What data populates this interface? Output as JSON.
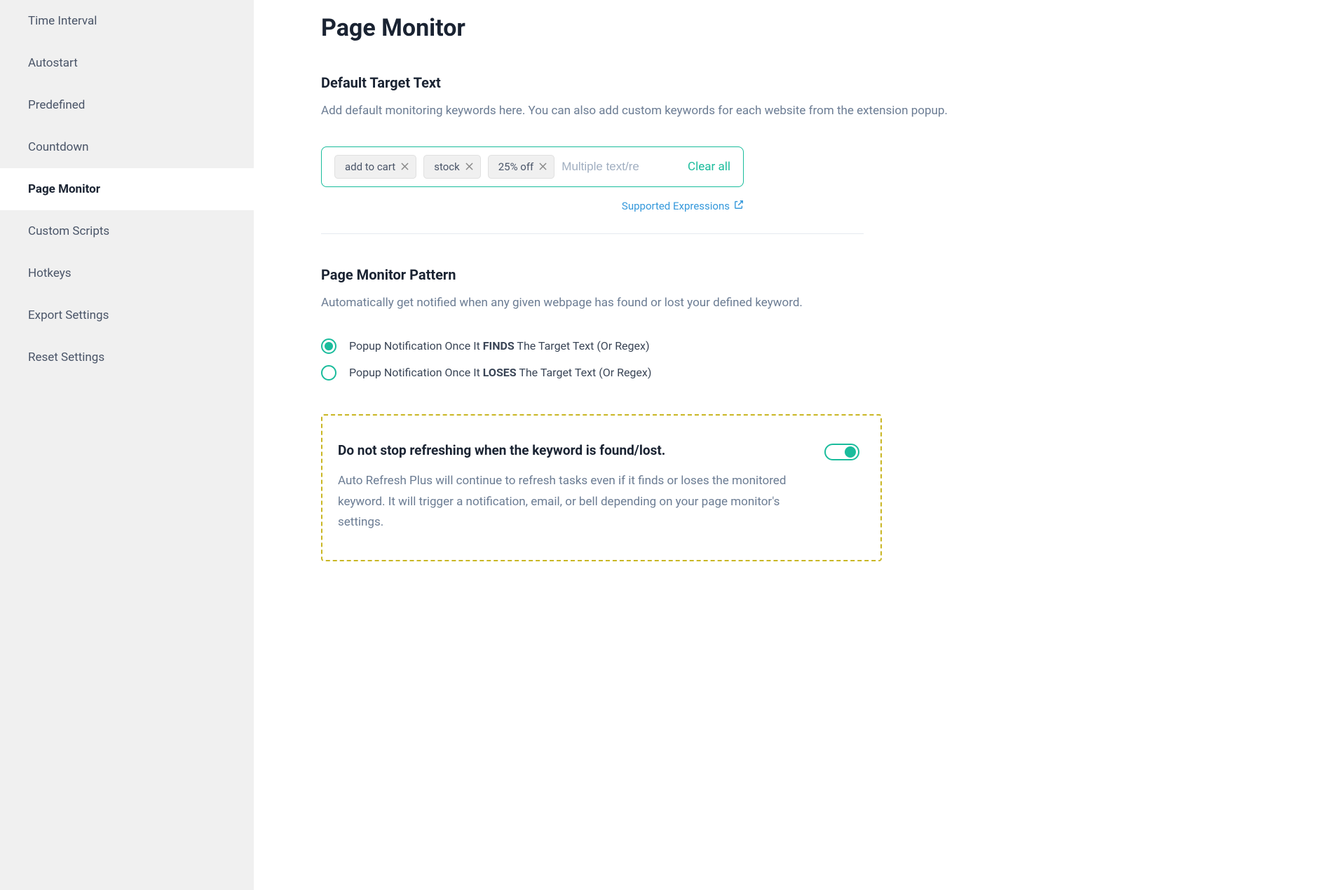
{
  "sidebar": {
    "items": [
      {
        "label": "Time Interval",
        "active": false
      },
      {
        "label": "Autostart",
        "active": false
      },
      {
        "label": "Predefined",
        "active": false
      },
      {
        "label": "Countdown",
        "active": false
      },
      {
        "label": "Page Monitor",
        "active": true
      },
      {
        "label": "Custom Scripts",
        "active": false
      },
      {
        "label": "Hotkeys",
        "active": false
      },
      {
        "label": "Export Settings",
        "active": false
      },
      {
        "label": "Reset Settings",
        "active": false
      }
    ]
  },
  "page": {
    "title": "Page Monitor"
  },
  "default_target": {
    "title": "Default Target Text",
    "description": "Add default monitoring keywords here. You can also add custom keywords for each website from the extension popup.",
    "tags": [
      "add to cart",
      "stock",
      "25% off"
    ],
    "input_placeholder": "Multiple text/re",
    "clear_all_label": "Clear all",
    "supported_link_label": "Supported Expressions"
  },
  "pattern": {
    "title": "Page Monitor Pattern",
    "description": "Automatically get notified when any given webpage has found or lost your defined keyword.",
    "options": [
      {
        "prefix": "Popup Notification Once It ",
        "bold": "FINDS",
        "suffix": " The Target Text (Or Regex)",
        "selected": true
      },
      {
        "prefix": "Popup Notification Once It ",
        "bold": "LOSES",
        "suffix": " The Target Text (Or Regex)",
        "selected": false
      }
    ]
  },
  "callout": {
    "title": "Do not stop refreshing when the keyword is found/lost.",
    "description": "Auto Refresh Plus will continue to refresh tasks even if it finds or loses the monitored keyword. It will trigger a notification, email, or bell depending on your page monitor's settings.",
    "toggle_on": true
  }
}
